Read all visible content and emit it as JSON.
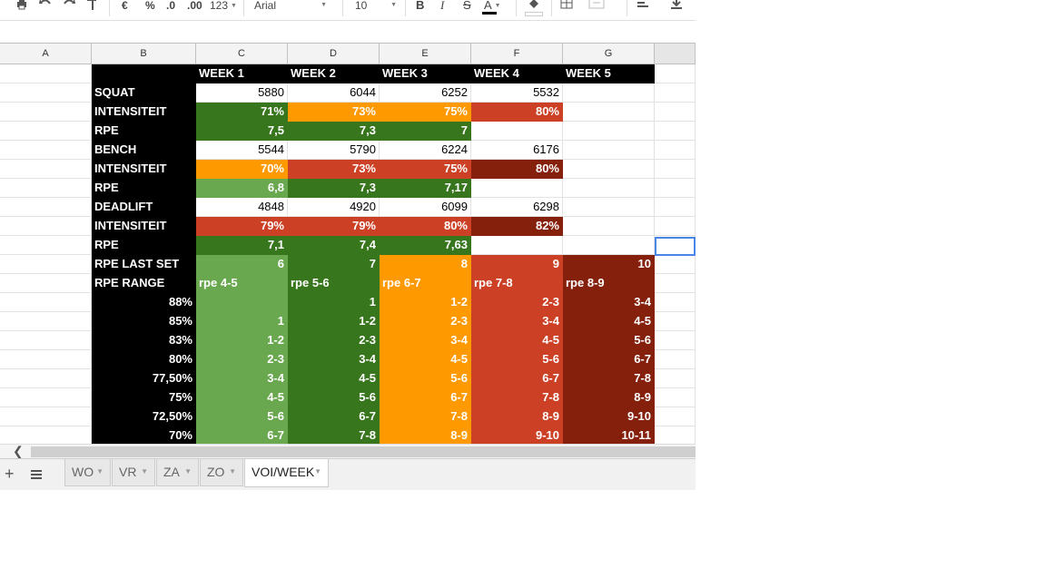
{
  "toolbar": {
    "percent_label": "%",
    "currency_label": "€",
    "decrease_decimals_label": ".0",
    "increase_decimals_label": ".00",
    "more_formats_label": "123",
    "font_name": "Arial",
    "font_size": "10",
    "bold_label": "B",
    "italic_label": "I",
    "strike_label": "S",
    "text_color_label": "A",
    "text_color_hex": "#000000"
  },
  "columns": [
    "A",
    "B",
    "C",
    "D",
    "E",
    "F",
    "G"
  ],
  "colors": {
    "black": "#000000",
    "dark_green": "#38761d",
    "light_green": "#6aa84f",
    "orange": "#ff9900",
    "red": "#cc4125",
    "dark_red": "#85200c",
    "selection_blue": "#4a86e8"
  },
  "rows": [
    [
      "",
      "",
      "WEEK 1",
      "WEEK 2",
      "WEEK 3",
      "WEEK 4",
      "WEEK 5"
    ],
    [
      "",
      "SQUAT",
      "5880",
      "6044",
      "6252",
      "5532",
      ""
    ],
    [
      "",
      "INTENSITEIT",
      "71%",
      "73%",
      "75%",
      "80%",
      ""
    ],
    [
      "",
      "RPE",
      "7,5",
      "7,3",
      "7",
      "",
      ""
    ],
    [
      "",
      "BENCH",
      "5544",
      "5790",
      "6224",
      "6176",
      ""
    ],
    [
      "",
      "INTENSITEIT",
      "70%",
      "73%",
      "75%",
      "80%",
      ""
    ],
    [
      "",
      "RPE",
      "6,8",
      "7,3",
      "7,17",
      "",
      ""
    ],
    [
      "",
      "DEADLIFT",
      "4848",
      "4920",
      "6099",
      "6298",
      ""
    ],
    [
      "",
      "INTENSITEIT",
      "79%",
      "79%",
      "80%",
      "82%",
      ""
    ],
    [
      "",
      "RPE",
      "7,1",
      "7,4",
      "7,63",
      "",
      ""
    ],
    [
      "",
      "RPE LAST SET",
      "6",
      "7",
      "8",
      "9",
      "10"
    ],
    [
      "",
      "RPE RANGE",
      "rpe 4-5",
      "rpe 5-6",
      "rpe 6-7",
      "rpe 7-8",
      "rpe 8-9"
    ],
    [
      "",
      "88%",
      "",
      "1",
      "1-2",
      "2-3",
      "3-4"
    ],
    [
      "",
      "85%",
      "1",
      "1-2",
      "2-3",
      "3-4",
      "4-5"
    ],
    [
      "",
      "83%",
      "1-2",
      "2-3",
      "3-4",
      "4-5",
      "5-6"
    ],
    [
      "",
      "80%",
      "2-3",
      "3-4",
      "4-5",
      "5-6",
      "6-7"
    ],
    [
      "",
      "77,50%",
      "3-4",
      "4-5",
      "5-6",
      "6-7",
      "7-8"
    ],
    [
      "",
      "75%",
      "4-5",
      "5-6",
      "6-7",
      "7-8",
      "8-9"
    ],
    [
      "",
      "72,50%",
      "5-6",
      "6-7",
      "7-8",
      "8-9",
      "9-10"
    ],
    [
      "",
      "70%",
      "6-7",
      "7-8",
      "8-9",
      "9-10",
      "10-11"
    ]
  ],
  "sheet_tabs": [
    {
      "label": "WO",
      "active": false
    },
    {
      "label": "VR",
      "active": false
    },
    {
      "label": "ZA",
      "active": false
    },
    {
      "label": "ZO",
      "active": false
    },
    {
      "label": "VOI/WEEK",
      "active": true
    }
  ]
}
